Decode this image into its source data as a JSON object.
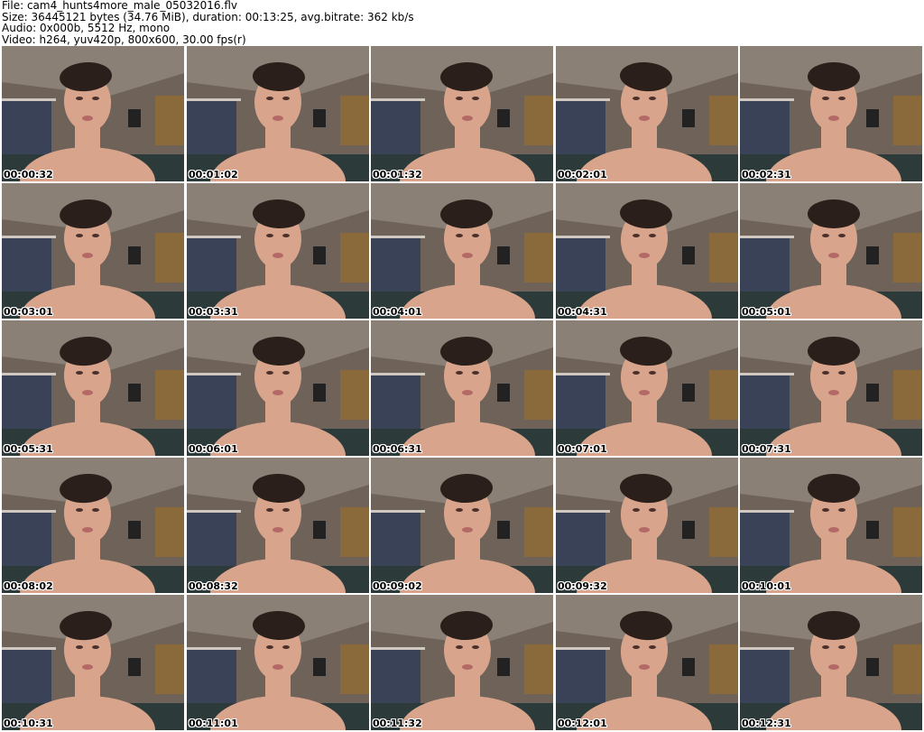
{
  "header": {
    "file": "File: cam4_hunts4more_male_05032016.flv",
    "size": "Size: 36445121 bytes (34.76 MiB), duration: 00:13:25, avg.bitrate: 362 kb/s",
    "audio": "Audio: 0x000b, 5512 Hz, mono",
    "video": "Video: h264, yuv420p, 800x600, 30.00 fps(r)"
  },
  "grid": {
    "columns": 5,
    "rows": 5
  },
  "frames": [
    {
      "timestamp": "00:00:32"
    },
    {
      "timestamp": "00:01:02"
    },
    {
      "timestamp": "00:01:32"
    },
    {
      "timestamp": "00:02:01"
    },
    {
      "timestamp": "00:02:31"
    },
    {
      "timestamp": "00:03:01"
    },
    {
      "timestamp": "00:03:31"
    },
    {
      "timestamp": "00:04:01"
    },
    {
      "timestamp": "00:04:31"
    },
    {
      "timestamp": "00:05:01"
    },
    {
      "timestamp": "00:05:31"
    },
    {
      "timestamp": "00:06:01"
    },
    {
      "timestamp": "00:06:31"
    },
    {
      "timestamp": "00:07:01"
    },
    {
      "timestamp": "00:07:31"
    },
    {
      "timestamp": "00:08:02"
    },
    {
      "timestamp": "00:08:32"
    },
    {
      "timestamp": "00:09:02"
    },
    {
      "timestamp": "00:09:32"
    },
    {
      "timestamp": "00:10:01"
    },
    {
      "timestamp": "00:10:31"
    },
    {
      "timestamp": "00:11:01"
    },
    {
      "timestamp": "00:11:32"
    },
    {
      "timestamp": "00:12:01"
    },
    {
      "timestamp": "00:12:31"
    }
  ],
  "colors": {
    "wall": "#6e6259",
    "ceiling": "#8a8076",
    "skin": "#d9a48c",
    "hair": "#2a1f1a",
    "clothes": "#3a4257",
    "cabinet": "#8a6a3a",
    "timestamp_text": "#000000",
    "timestamp_outline": "#ffffff"
  }
}
